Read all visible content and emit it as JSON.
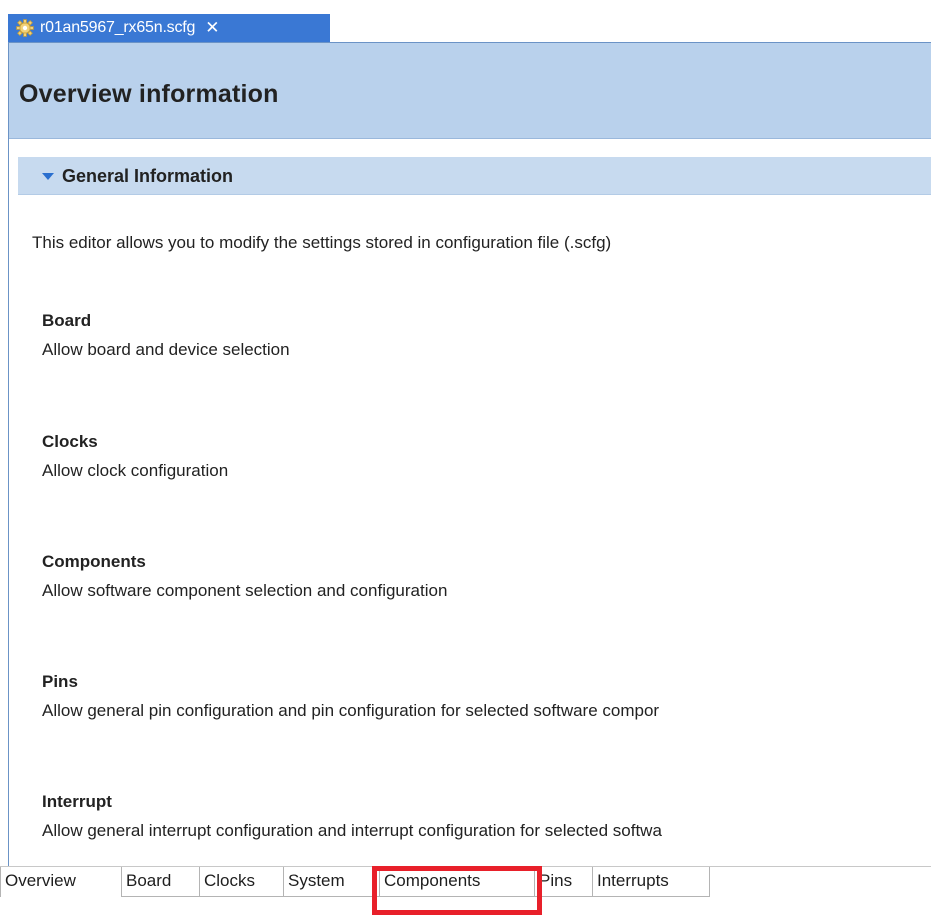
{
  "editor_tab": {
    "title": "r01an5967_rx65n.scfg",
    "close_glyph": "✕"
  },
  "header": {
    "title": "Overview information"
  },
  "section": {
    "title": "General Information",
    "intro": "This editor allows you to modify the settings stored in configuration file (.scfg)"
  },
  "items": [
    {
      "title": "Board",
      "description": "Allow board and device selection"
    },
    {
      "title": "Clocks",
      "description": "Allow clock configuration"
    },
    {
      "title": "Components",
      "description": "Allow software component selection and configuration"
    },
    {
      "title": "Pins",
      "description": "Allow general pin configuration and pin configuration for selected software compor"
    },
    {
      "title": "Interrupt",
      "description": "Allow general interrupt configuration and interrupt configuration for selected softwa"
    }
  ],
  "page_tabs": [
    {
      "label": "Overview"
    },
    {
      "label": "Board"
    },
    {
      "label": "Clocks"
    },
    {
      "label": "System"
    },
    {
      "label": "Components"
    },
    {
      "label": "Pins"
    },
    {
      "label": "Interrupts"
    }
  ],
  "colors": {
    "tab_active": "#3a78d4",
    "header_band": "#b9d1ec",
    "section_header": "#c7daef",
    "highlight": "#e8202a"
  }
}
